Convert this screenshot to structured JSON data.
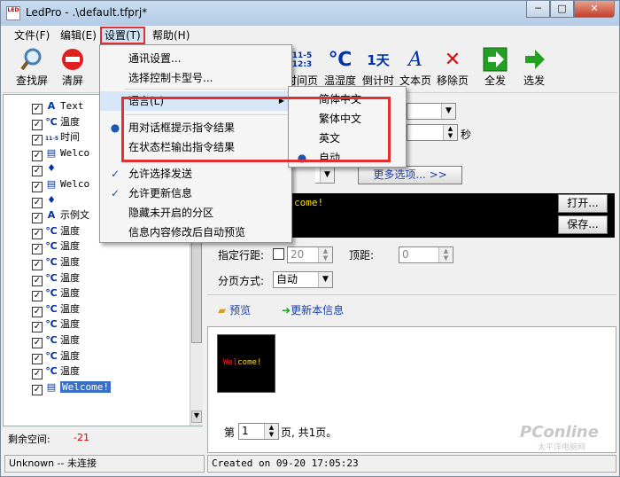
{
  "window": {
    "title": "LedPro - .\\default.tfprj*",
    "icon_text": "LED",
    "controls": {
      "minimize": "─",
      "maximize": "□",
      "close": "✕"
    }
  },
  "menubar": {
    "items": [
      {
        "label": "文件(F)"
      },
      {
        "label": "编辑(E)"
      },
      {
        "label": "设置(T)"
      },
      {
        "label": "帮助(H)"
      }
    ]
  },
  "toolbar": {
    "left": [
      {
        "label": "查找屏",
        "icon": "magnifier-icon"
      },
      {
        "label": "清屏",
        "icon": "no-entry-icon"
      }
    ],
    "right": [
      {
        "label": "时间页",
        "icon_text": "11-5\n12:3"
      },
      {
        "label": "温湿度",
        "icon_text": "℃"
      },
      {
        "label": "倒计时",
        "icon_text": "1天"
      },
      {
        "label": "文本页",
        "icon_text": "A"
      },
      {
        "label": "移除页",
        "icon_text": "✕"
      },
      {
        "label": "全发",
        "icon_text": "➜"
      },
      {
        "label": "选发",
        "icon_text": "➜"
      }
    ]
  },
  "tree": {
    "items": [
      {
        "icon": "A",
        "label": "Text"
      },
      {
        "icon": "℃",
        "label": "温度"
      },
      {
        "icon": "11-5",
        "label": "时间"
      },
      {
        "icon": "▤",
        "label": "Welco"
      },
      {
        "icon": "♦",
        "label": ""
      },
      {
        "icon": "▤",
        "label": "Welco"
      },
      {
        "icon": "♦",
        "label": ""
      },
      {
        "icon": "A",
        "label": "示例文"
      },
      {
        "icon": "℃",
        "label": "温度"
      },
      {
        "icon": "℃",
        "label": "温度"
      },
      {
        "icon": "℃",
        "label": "温度"
      },
      {
        "icon": "℃",
        "label": "温度"
      },
      {
        "icon": "℃",
        "label": "温度"
      },
      {
        "icon": "℃",
        "label": "温度"
      },
      {
        "icon": "℃",
        "label": "温度"
      },
      {
        "icon": "℃",
        "label": "温度"
      },
      {
        "icon": "℃",
        "label": "温度"
      },
      {
        "icon": "℃",
        "label": "温度"
      },
      {
        "icon": "▤",
        "label": "Welcome!"
      }
    ]
  },
  "free_space": {
    "label": "剩余空间:",
    "value": "-21"
  },
  "settings_menu": {
    "items": [
      {
        "label": "通讯设置...",
        "mark": ""
      },
      {
        "label": "选择控制卡型号...",
        "mark": ""
      },
      {
        "label": "语言(L)",
        "mark": "",
        "submenu_arrow": "▶"
      },
      {
        "label": "用对话框提示指令结果",
        "mark": "●"
      },
      {
        "label": "在状态栏输出指令结果",
        "mark": ""
      },
      {
        "label": "允许选择发送",
        "mark": "✓"
      },
      {
        "label": "允许更新信息",
        "mark": "✓"
      },
      {
        "label": "隐藏未开启的分区",
        "mark": ""
      },
      {
        "label": "信息内容修改后自动预览",
        "mark": ""
      }
    ]
  },
  "language_submenu": {
    "items": [
      {
        "label": "简体中文",
        "mark": ""
      },
      {
        "label": "繁体中文",
        "mark": ""
      },
      {
        "label": "英文",
        "mark": ""
      },
      {
        "label": "自动",
        "mark": "●"
      }
    ]
  },
  "right_panel": {
    "seconds_unit": "秒",
    "more_options": "更多选项... >>",
    "message_text": "come!",
    "open_button": "打开...",
    "save_button": "保存...",
    "line_spacing_label": "指定行距:",
    "line_spacing_value": "20",
    "top_distance_label": "顶距:",
    "top_distance_value": "0",
    "paging_label": "分页方式:",
    "paging_value": "自动",
    "preview_link": "预览",
    "update_link": "更新本信息",
    "preview_text_red": "Wel",
    "preview_text_yellow": "come!",
    "page_prefix": "第",
    "page_value": "1",
    "page_suffix": "页, 共1页。",
    "watermark": "PConline",
    "watermark_sub": "太平洋电脑网"
  },
  "status": {
    "left": "Unknown -- 未连接",
    "right": "Created on 09-20 17:05:23"
  },
  "colors": {
    "highlight": "#e0302f",
    "accent_blue": "#1b55b5",
    "led_yellow": "#ffe000",
    "led_red": "#ff2020"
  }
}
